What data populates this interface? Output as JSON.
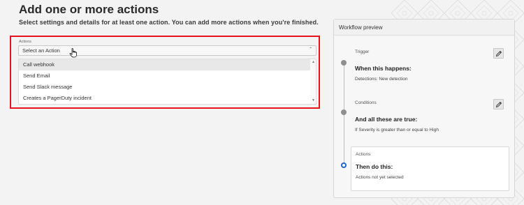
{
  "page": {
    "title": "Add one or more actions",
    "subtitle": "Select settings and details for at least one action. You can add more actions when you're finished."
  },
  "actions_field": {
    "label": "Actions",
    "placeholder": "Select an Action",
    "chevron_icon": "chevron-up-icon",
    "options": [
      "Call webhook",
      "Send Email",
      "Send Slack message",
      "Creates a PagerDuty incident"
    ],
    "hovered_option": "Call webhook"
  },
  "workflow_preview": {
    "title": "Workflow preview",
    "trigger": {
      "label": "Trigger",
      "heading": "When this happens:",
      "detail": "Detections: New detection"
    },
    "conditions": {
      "label": "Conditions",
      "heading": "And all these are true:",
      "detail": "If Severity is greater than or equal to High"
    },
    "actions": {
      "label": "Actions",
      "heading": "Then do this:",
      "detail": "Actions not yet selected"
    }
  },
  "colors": {
    "highlight": "#e8121b",
    "active_step": "#1f66d1"
  }
}
